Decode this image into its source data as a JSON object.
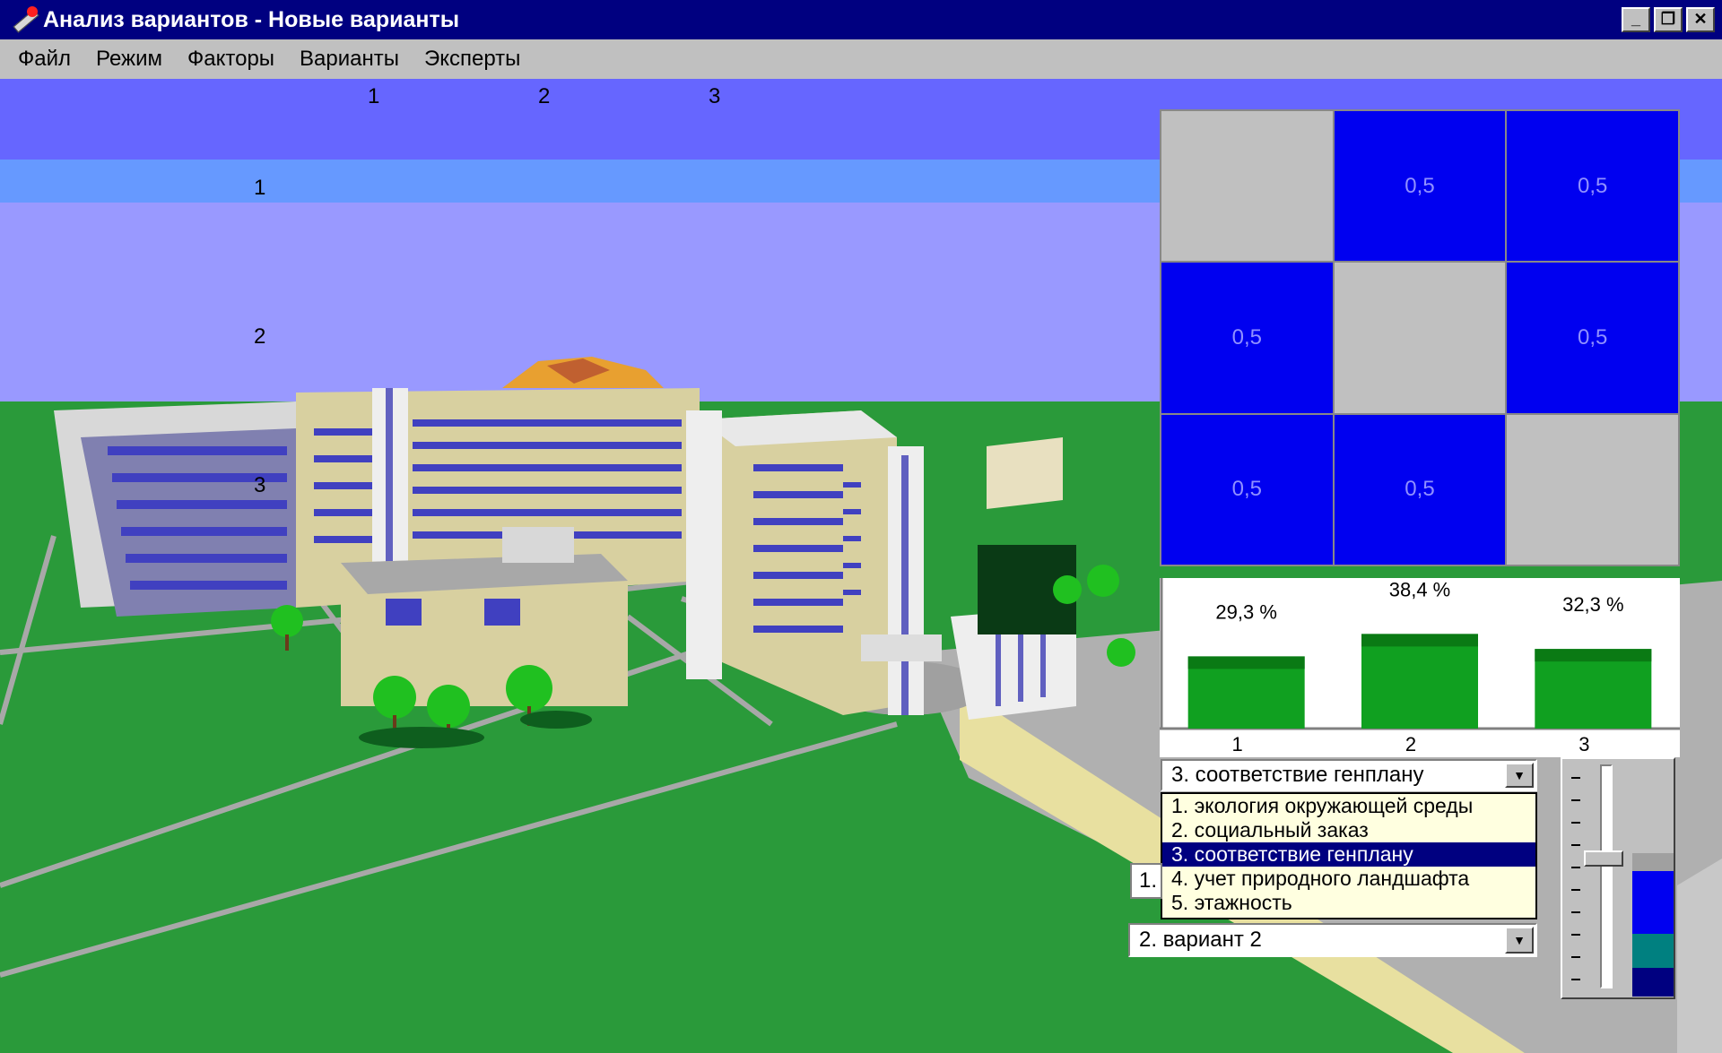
{
  "window": {
    "title": "Анализ вариантов - Новые варианты",
    "controls": [
      "_",
      "❐",
      "✕"
    ]
  },
  "menu": [
    "Файл",
    "Режим",
    "Факторы",
    "Варианты",
    "Эксперты"
  ],
  "scene_labels": {
    "columns": [
      "1",
      "2",
      "3"
    ],
    "rows": [
      "1",
      "2",
      "3"
    ]
  },
  "matrix": {
    "cells": [
      [
        "",
        "0,5",
        "0,5"
      ],
      [
        "0,5",
        "",
        "0,5"
      ],
      [
        "0,5",
        "0,5",
        ""
      ]
    ],
    "colors": {
      "value": "#0000f0",
      "empty": "#c0c0c0"
    }
  },
  "chart_data": {
    "type": "bar",
    "categories": [
      "1",
      "2",
      "3"
    ],
    "values": [
      29.3,
      38.4,
      32.3
    ],
    "data_labels": [
      "29,3 %",
      "38,4 %",
      "32,3 %"
    ],
    "title": "",
    "xlabel": "",
    "ylabel": "",
    "color": "#10a020"
  },
  "factor_select": {
    "value": "3. соответствие генплану",
    "options": [
      "1. экология окружающей среды",
      "2. социальный заказ",
      "3. соответствие генплану",
      "4. учет природного ландшафта",
      "5. этажность"
    ],
    "selected_index": 2
  },
  "variant_select": {
    "peek": "1.",
    "value": "2. вариант 2"
  },
  "slider": {
    "level": 0.58
  },
  "level_bar": {
    "colors": [
      "#0000f0",
      "#008080",
      "#000080"
    ]
  }
}
